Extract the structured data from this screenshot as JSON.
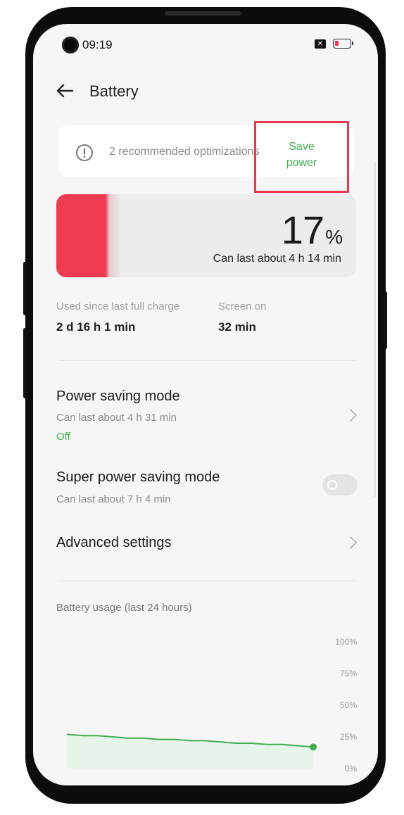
{
  "status_bar": {
    "time": "09:19",
    "sim_icon": "sim-off-icon",
    "battery_icon": "battery-low-icon"
  },
  "header": {
    "title": "Battery",
    "back_icon": "back-arrow-icon"
  },
  "recommendation": {
    "text": "2 recommended optimizations",
    "action_label": "Save power",
    "icon": "info-icon"
  },
  "battery": {
    "percent": "17",
    "percent_sign": "%",
    "level_fraction": 0.17,
    "estimate": "Can last about 4 h 14 min"
  },
  "stats": {
    "used_label": "Used since last full charge",
    "used_value": "2 d 16 h 1 min",
    "screen_label": "Screen on",
    "screen_value": "32 min"
  },
  "settings": {
    "power_saving": {
      "title": "Power saving mode",
      "subtitle": "Can last about 4 h 31 min",
      "status": "Off"
    },
    "super_power_saving": {
      "title": "Super power saving mode",
      "subtitle": "Can last about 7 h 4 min",
      "enabled": false
    },
    "advanced": {
      "title": "Advanced settings"
    }
  },
  "usage": {
    "title": "Battery usage (last 24 hours)"
  },
  "colors": {
    "accent_green": "#3fae4f",
    "battery_red": "#ef3b52",
    "highlight_red": "#e8384f"
  },
  "chart_data": {
    "type": "area",
    "title": "Battery usage (last 24 hours)",
    "y_ticks": [
      "100%",
      "75%",
      "50%",
      "25%",
      "0%"
    ],
    "ylim": [
      0,
      100
    ],
    "series": [
      {
        "values": [
          27,
          26,
          26,
          25,
          24,
          24,
          23,
          23,
          22,
          22,
          21,
          20,
          20,
          19,
          19,
          18,
          17
        ]
      }
    ],
    "grid": false,
    "legend": "none"
  }
}
